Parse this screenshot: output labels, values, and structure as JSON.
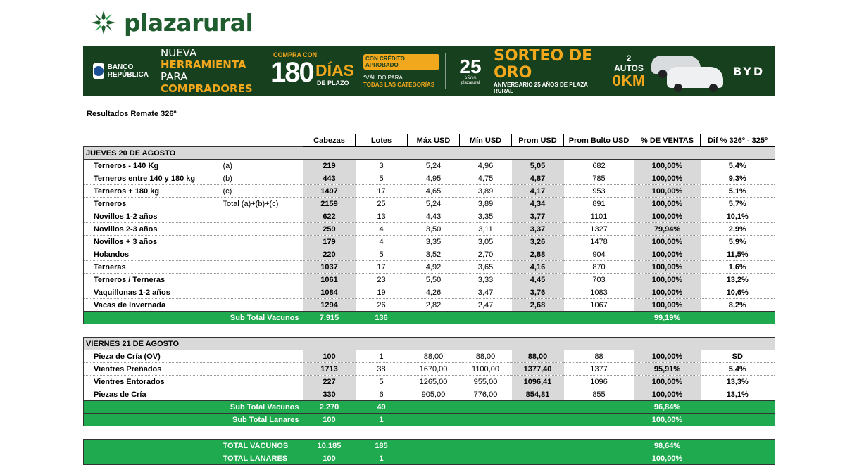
{
  "brand": {
    "name": "plazarural"
  },
  "banner": {
    "bank": "BANCO REPÚBLICA",
    "nueva_1": "NUEVA ",
    "nueva_2": "HERRAMIENTA",
    "nueva_3": "PARA ",
    "nueva_4": "COMPRADORES",
    "compra": "COMPRA CON",
    "dias_num": "180",
    "dias": "DÍAS",
    "plazo": "DE PLAZO",
    "credito": "CON CRÉDITO APROBADO",
    "valido": "*VÁLIDO PARA",
    "todas": "TODAS LAS CATEGORÍAS",
    "anos_num": "25",
    "anos_small": "AÑOS plazarural",
    "sorteo": "SORTEO DE ORO",
    "aniversario": "ANIVERSARIO 25 AÑOS DE PLAZA RURAL",
    "autos": "2 AUTOS",
    "okm": "0KM",
    "byd": "BYD"
  },
  "subtitle": "Resultados Remate 326º",
  "headers": [
    "Cabezas",
    "Lotes",
    "Máx USD",
    "Mín USD",
    "Prom USD",
    "Prom Bulto USD",
    "% DE VENTAS",
    "Dif % 326º - 325º"
  ],
  "day1": {
    "title": "JUEVES 20 DE AGOSTO",
    "rows": [
      {
        "name": "Terneros - 140 Kg",
        "note": "(a)",
        "cab": "219",
        "lotes": "3",
        "max": "5,24",
        "min": "4,96",
        "prom": "5,05",
        "bulto": "682",
        "ventas": "100,00%",
        "dif": "5,4%"
      },
      {
        "name": "Terneros entre 140 y 180 kg",
        "note": "(b)",
        "cab": "443",
        "lotes": "5",
        "max": "4,95",
        "min": "4,75",
        "prom": "4,87",
        "bulto": "785",
        "ventas": "100,00%",
        "dif": "9,3%"
      },
      {
        "name": "Terneros + 180 kg",
        "note": "(c)",
        "cab": "1497",
        "lotes": "17",
        "max": "4,65",
        "min": "3,89",
        "prom": "4,17",
        "bulto": "953",
        "ventas": "100,00%",
        "dif": "5,1%"
      },
      {
        "name": "Terneros",
        "note": "Total (a)+(b)+(c)",
        "cab": "2159",
        "lotes": "25",
        "max": "5,24",
        "min": "3,89",
        "prom": "4,34",
        "bulto": "891",
        "ventas": "100,00%",
        "dif": "5,7%"
      },
      {
        "name": "Novillos 1-2 años",
        "note": "",
        "cab": "622",
        "lotes": "13",
        "max": "4,43",
        "min": "3,35",
        "prom": "3,77",
        "bulto": "1101",
        "ventas": "100,00%",
        "dif": "10,1%"
      },
      {
        "name": "Novillos 2-3 años",
        "note": "",
        "cab": "259",
        "lotes": "4",
        "max": "3,50",
        "min": "3,11",
        "prom": "3,37",
        "bulto": "1327",
        "ventas": "79,94%",
        "dif": "2,9%"
      },
      {
        "name": "Novillos + 3 años",
        "note": "",
        "cab": "179",
        "lotes": "4",
        "max": "3,35",
        "min": "3,05",
        "prom": "3,26",
        "bulto": "1478",
        "ventas": "100,00%",
        "dif": "5,9%"
      },
      {
        "name": "Holandos",
        "note": "",
        "cab": "220",
        "lotes": "5",
        "max": "3,52",
        "min": "2,70",
        "prom": "2,88",
        "bulto": "904",
        "ventas": "100,00%",
        "dif": "11,5%"
      },
      {
        "name": "Terneras",
        "note": "",
        "cab": "1037",
        "lotes": "17",
        "max": "4,92",
        "min": "3,65",
        "prom": "4,16",
        "bulto": "870",
        "ventas": "100,00%",
        "dif": "1,6%"
      },
      {
        "name": "Terneros / Terneras",
        "note": "",
        "cab": "1061",
        "lotes": "23",
        "max": "5,50",
        "min": "3,33",
        "prom": "4,45",
        "bulto": "703",
        "ventas": "100,00%",
        "dif": "13,2%"
      },
      {
        "name": "Vaquillonas 1-2 años",
        "note": "",
        "cab": "1084",
        "lotes": "19",
        "max": "4,26",
        "min": "3,47",
        "prom": "3,76",
        "bulto": "1083",
        "ventas": "100,00%",
        "dif": "10,6%"
      },
      {
        "name": "Vacas de Invernada",
        "note": "",
        "cab": "1294",
        "lotes": "26",
        "max": "2,82",
        "min": "2,47",
        "prom": "2,68",
        "bulto": "1067",
        "ventas": "100,00%",
        "dif": "8,2%"
      }
    ],
    "subtotal": {
      "label": "Sub Total Vacunos",
      "cab": "7.915",
      "lotes": "136",
      "ventas": "99,19%"
    }
  },
  "day2": {
    "title": "VIERNES 21 DE AGOSTO",
    "rows": [
      {
        "name": "Pieza de Cría (OV)",
        "cab": "100",
        "lotes": "1",
        "max": "88,00",
        "min": "88,00",
        "prom": "88,00",
        "bulto": "88",
        "ventas": "100,00%",
        "dif": "SD"
      },
      {
        "name": "Vientres Preñados",
        "cab": "1713",
        "lotes": "38",
        "max": "1670,00",
        "min": "1100,00",
        "prom": "1377,40",
        "bulto": "1377",
        "ventas": "95,91%",
        "dif": "5,4%"
      },
      {
        "name": "Vientres Entorados",
        "cab": "227",
        "lotes": "5",
        "max": "1265,00",
        "min": "955,00",
        "prom": "1096,41",
        "bulto": "1096",
        "ventas": "100,00%",
        "dif": "13,3%"
      },
      {
        "name": "Piezas de Cría",
        "cab": "330",
        "lotes": "6",
        "max": "905,00",
        "min": "776,00",
        "prom": "854,81",
        "bulto": "855",
        "ventas": "100,00%",
        "dif": "13,1%"
      }
    ],
    "subtotal_vacunos": {
      "label": "Sub Total Vacunos",
      "cab": "2.270",
      "lotes": "49",
      "ventas": "96,84%"
    },
    "subtotal_lanares": {
      "label": "Sub Total Lanares",
      "cab": "100",
      "lotes": "1",
      "ventas": "100,00%"
    }
  },
  "totals": {
    "vacunos": {
      "label": "TOTAL VACUNOS",
      "cab": "10.185",
      "lotes": "185",
      "ventas": "98,64%"
    },
    "lanares": {
      "label": "TOTAL LANARES",
      "cab": "100",
      "lotes": "1",
      "ventas": "100,00%"
    }
  },
  "colors": {
    "green_total": "#1faa4f",
    "brand_green": "#1f5c2e",
    "banner_bg": "#17401e",
    "accent": "#f2a81d",
    "grey": "#d9d9d9"
  }
}
